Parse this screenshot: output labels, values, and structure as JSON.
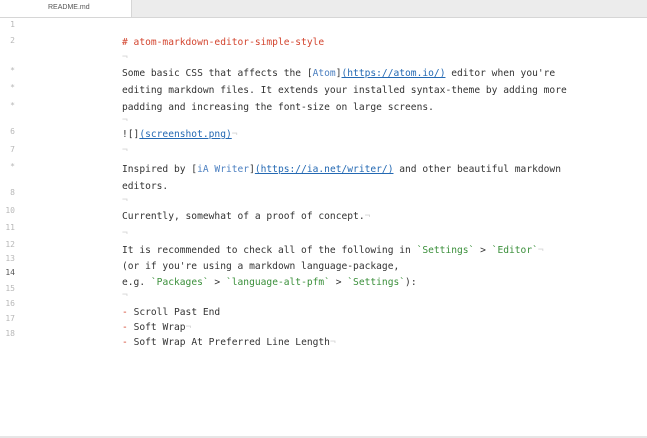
{
  "tabs": [
    {
      "label": "README.md"
    }
  ],
  "gutter": {
    "numbers": [
      "1",
      "2",
      "*",
      "*",
      "*",
      "6",
      "7",
      "*",
      "8",
      "10",
      "11",
      "12",
      "13",
      "14",
      "15",
      "16",
      "17",
      "18"
    ]
  },
  "lines": {
    "heading": "# atom-markdown-editor-simple-style",
    "p1_before": "Some basic CSS that affects the [",
    "p1_link_text": "Atom",
    "p1_bracket_close": "]",
    "p1_url": "(https://atom.io/)",
    "p1_after": " editor when you're",
    "p1_line2": "editing markdown files. It extends your installed syntax-theme by adding more",
    "p1_line3": "padding and increasing the font-size on large screens.",
    "img_prefix": "![]",
    "img_url": "(screenshot.png)",
    "p2_before": "Inspired by [",
    "p2_link_text": "iA Writer",
    "p2_bracket_close": "]",
    "p2_url": "(https://ia.net/writer/)",
    "p2_after": " and other beautiful markdown",
    "p2_line2": "editors.",
    "p3": "Currently, somewhat of a proof of concept.",
    "p4_before": "It is recommended to check all of the following in ",
    "p4_code1": "`Settings`",
    "p4_sep1": " > ",
    "p4_code2": "`Editor`",
    "p4_line2": "(or if you're using a markdown language-package,",
    "p4_l3_before": "e.g. ",
    "p4_code3": "`Packages`",
    "p4_sep2": " > ",
    "p4_code4": "`language-alt-pfm`",
    "p4_sep3": " > ",
    "p4_code5": "`Settings`",
    "p4_l3_after": "):",
    "bullet_marker": "-",
    "bullets": [
      "Scroll Past End",
      "Soft Wrap",
      "Soft Wrap At Preferred Line Length"
    ],
    "ws_marker": "¬",
    "blank_marker": "¬"
  },
  "colors": {
    "heading": "#d3452f",
    "link": "#2469b3",
    "code": "#3a8f3a",
    "text": "#333333"
  }
}
